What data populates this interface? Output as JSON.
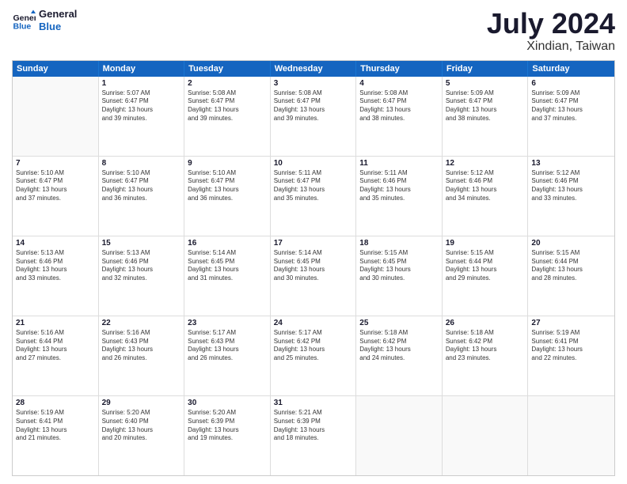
{
  "logo": {
    "line1": "General",
    "line2": "Blue"
  },
  "header": {
    "month_year": "July 2024",
    "location": "Xindian, Taiwan"
  },
  "days": [
    "Sunday",
    "Monday",
    "Tuesday",
    "Wednesday",
    "Thursday",
    "Friday",
    "Saturday"
  ],
  "rows": [
    [
      {
        "day": "",
        "info": ""
      },
      {
        "day": "1",
        "info": "Sunrise: 5:07 AM\nSunset: 6:47 PM\nDaylight: 13 hours\nand 39 minutes."
      },
      {
        "day": "2",
        "info": "Sunrise: 5:08 AM\nSunset: 6:47 PM\nDaylight: 13 hours\nand 39 minutes."
      },
      {
        "day": "3",
        "info": "Sunrise: 5:08 AM\nSunset: 6:47 PM\nDaylight: 13 hours\nand 39 minutes."
      },
      {
        "day": "4",
        "info": "Sunrise: 5:08 AM\nSunset: 6:47 PM\nDaylight: 13 hours\nand 38 minutes."
      },
      {
        "day": "5",
        "info": "Sunrise: 5:09 AM\nSunset: 6:47 PM\nDaylight: 13 hours\nand 38 minutes."
      },
      {
        "day": "6",
        "info": "Sunrise: 5:09 AM\nSunset: 6:47 PM\nDaylight: 13 hours\nand 37 minutes."
      }
    ],
    [
      {
        "day": "7",
        "info": "Sunrise: 5:10 AM\nSunset: 6:47 PM\nDaylight: 13 hours\nand 37 minutes."
      },
      {
        "day": "8",
        "info": "Sunrise: 5:10 AM\nSunset: 6:47 PM\nDaylight: 13 hours\nand 36 minutes."
      },
      {
        "day": "9",
        "info": "Sunrise: 5:10 AM\nSunset: 6:47 PM\nDaylight: 13 hours\nand 36 minutes."
      },
      {
        "day": "10",
        "info": "Sunrise: 5:11 AM\nSunset: 6:47 PM\nDaylight: 13 hours\nand 35 minutes."
      },
      {
        "day": "11",
        "info": "Sunrise: 5:11 AM\nSunset: 6:46 PM\nDaylight: 13 hours\nand 35 minutes."
      },
      {
        "day": "12",
        "info": "Sunrise: 5:12 AM\nSunset: 6:46 PM\nDaylight: 13 hours\nand 34 minutes."
      },
      {
        "day": "13",
        "info": "Sunrise: 5:12 AM\nSunset: 6:46 PM\nDaylight: 13 hours\nand 33 minutes."
      }
    ],
    [
      {
        "day": "14",
        "info": "Sunrise: 5:13 AM\nSunset: 6:46 PM\nDaylight: 13 hours\nand 33 minutes."
      },
      {
        "day": "15",
        "info": "Sunrise: 5:13 AM\nSunset: 6:46 PM\nDaylight: 13 hours\nand 32 minutes."
      },
      {
        "day": "16",
        "info": "Sunrise: 5:14 AM\nSunset: 6:45 PM\nDaylight: 13 hours\nand 31 minutes."
      },
      {
        "day": "17",
        "info": "Sunrise: 5:14 AM\nSunset: 6:45 PM\nDaylight: 13 hours\nand 30 minutes."
      },
      {
        "day": "18",
        "info": "Sunrise: 5:15 AM\nSunset: 6:45 PM\nDaylight: 13 hours\nand 30 minutes."
      },
      {
        "day": "19",
        "info": "Sunrise: 5:15 AM\nSunset: 6:44 PM\nDaylight: 13 hours\nand 29 minutes."
      },
      {
        "day": "20",
        "info": "Sunrise: 5:15 AM\nSunset: 6:44 PM\nDaylight: 13 hours\nand 28 minutes."
      }
    ],
    [
      {
        "day": "21",
        "info": "Sunrise: 5:16 AM\nSunset: 6:44 PM\nDaylight: 13 hours\nand 27 minutes."
      },
      {
        "day": "22",
        "info": "Sunrise: 5:16 AM\nSunset: 6:43 PM\nDaylight: 13 hours\nand 26 minutes."
      },
      {
        "day": "23",
        "info": "Sunrise: 5:17 AM\nSunset: 6:43 PM\nDaylight: 13 hours\nand 26 minutes."
      },
      {
        "day": "24",
        "info": "Sunrise: 5:17 AM\nSunset: 6:42 PM\nDaylight: 13 hours\nand 25 minutes."
      },
      {
        "day": "25",
        "info": "Sunrise: 5:18 AM\nSunset: 6:42 PM\nDaylight: 13 hours\nand 24 minutes."
      },
      {
        "day": "26",
        "info": "Sunrise: 5:18 AM\nSunset: 6:42 PM\nDaylight: 13 hours\nand 23 minutes."
      },
      {
        "day": "27",
        "info": "Sunrise: 5:19 AM\nSunset: 6:41 PM\nDaylight: 13 hours\nand 22 minutes."
      }
    ],
    [
      {
        "day": "28",
        "info": "Sunrise: 5:19 AM\nSunset: 6:41 PM\nDaylight: 13 hours\nand 21 minutes."
      },
      {
        "day": "29",
        "info": "Sunrise: 5:20 AM\nSunset: 6:40 PM\nDaylight: 13 hours\nand 20 minutes."
      },
      {
        "day": "30",
        "info": "Sunrise: 5:20 AM\nSunset: 6:39 PM\nDaylight: 13 hours\nand 19 minutes."
      },
      {
        "day": "31",
        "info": "Sunrise: 5:21 AM\nSunset: 6:39 PM\nDaylight: 13 hours\nand 18 minutes."
      },
      {
        "day": "",
        "info": ""
      },
      {
        "day": "",
        "info": ""
      },
      {
        "day": "",
        "info": ""
      }
    ]
  ]
}
